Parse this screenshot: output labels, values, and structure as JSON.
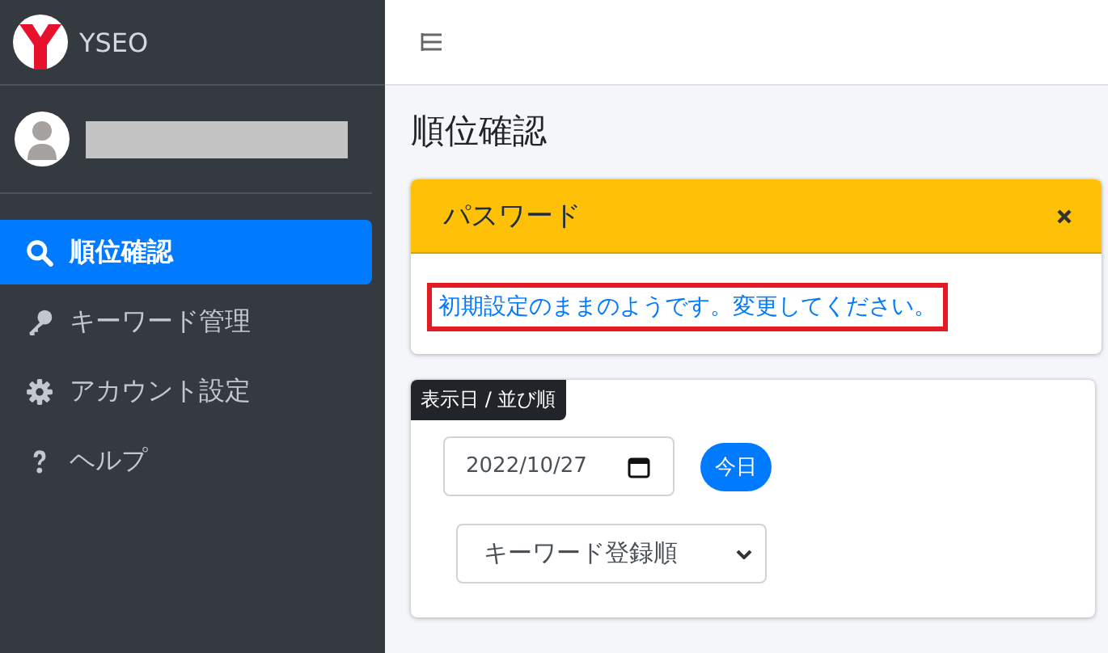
{
  "brand": {
    "name": "YSEO"
  },
  "nav": [
    {
      "label": "順位確認",
      "selected": true
    },
    {
      "label": "キーワード管理",
      "selected": false
    },
    {
      "label": "アカウント設定",
      "selected": false
    },
    {
      "label": "ヘルプ",
      "selected": false
    }
  ],
  "page_title": "順位確認",
  "alert": {
    "title": "パスワード",
    "message": "初期設定のままのようです。変更してください。"
  },
  "filter": {
    "label": "表示日 / 並び順",
    "date": "2022/10/27",
    "today_button": "今日",
    "sort": "キーワード登録順"
  }
}
